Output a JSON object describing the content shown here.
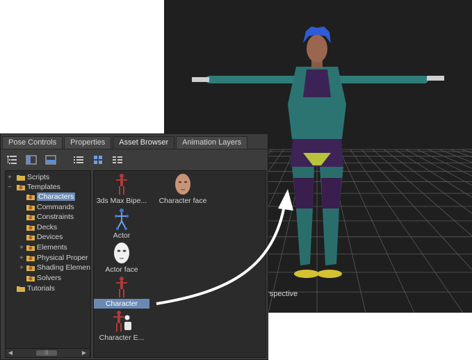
{
  "viewport": {
    "label": "erspective"
  },
  "panel": {
    "tabs": [
      {
        "label": "Pose Controls",
        "active": false
      },
      {
        "label": "Properties",
        "active": false
      },
      {
        "label": "Asset Browser",
        "active": true
      },
      {
        "label": "Animation Layers",
        "active": false
      }
    ],
    "tree": {
      "nodes": [
        {
          "label": "Scripts"
        },
        {
          "label": "Templates"
        },
        {
          "label": "Characters"
        },
        {
          "label": "Commands"
        },
        {
          "label": "Constraints"
        },
        {
          "label": "Decks"
        },
        {
          "label": "Devices"
        },
        {
          "label": "Elements"
        },
        {
          "label": "Physical Proper"
        },
        {
          "label": "Shading Elemen"
        },
        {
          "label": "Solvers"
        },
        {
          "label": "Tutorials"
        }
      ]
    },
    "assets": [
      {
        "label": "3ds Max Bipe..."
      },
      {
        "label": "Character face"
      },
      {
        "label": "Actor"
      },
      {
        "label": "Actor face"
      },
      {
        "label": "Character"
      },
      {
        "label": "Character E..."
      }
    ],
    "scrollbar": {
      "grip": "|||"
    }
  },
  "colors": {
    "selection": "#6a8ab4",
    "panel_bg": "#3c3c3c",
    "pane_bg": "#2b2b2b",
    "viewport_bg": "#1f1f1f",
    "hair": "#2f5bd6",
    "suit": "#2a6e6c",
    "suit_dark": "#3a1f4e"
  }
}
